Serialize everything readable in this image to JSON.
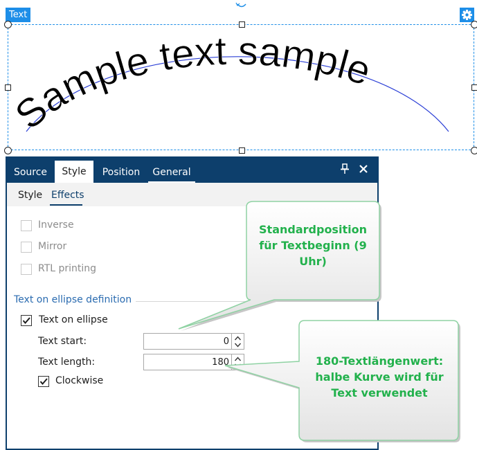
{
  "object": {
    "tag_label": "Text",
    "curved_text": "Sample text sample",
    "tag_color": "#1d8ee8"
  },
  "icons": {
    "settings": "gear-icon",
    "rotate": "rotate-icon",
    "pin": "pin-icon",
    "close": "close-icon",
    "checkmark": "checkmark-icon",
    "spin_up": "chevron-up-icon",
    "spin_down": "chevron-down-icon"
  },
  "panel": {
    "tabs": [
      {
        "label": "Source",
        "active": false
      },
      {
        "label": "Style",
        "active": true
      },
      {
        "label": "Position",
        "active": false
      },
      {
        "label": "General",
        "active": false
      }
    ],
    "subtabs": [
      {
        "label": "Style",
        "active": false
      },
      {
        "label": "Effects",
        "active": true
      }
    ],
    "header_color": "#0d3f6c"
  },
  "effects": {
    "inverse": {
      "label": "Inverse",
      "checked": false,
      "enabled": false
    },
    "mirror": {
      "label": "Mirror",
      "checked": false,
      "enabled": false
    },
    "rtl": {
      "label": "RTL printing",
      "checked": false,
      "enabled": false
    }
  },
  "ellipse": {
    "section_title": "Text on ellipse definition",
    "enable": {
      "label": "Text on ellipse",
      "checked": true
    },
    "text_start": {
      "label": "Text start:",
      "value": "0"
    },
    "text_length": {
      "label": "Text length:",
      "value": "180"
    },
    "clockwise": {
      "label": "Clockwise",
      "checked": true
    }
  },
  "callouts": [
    {
      "text": "Standardposition für Textbeginn (9 Uhr)"
    },
    {
      "text": "180-Textlängenwert: halbe Kurve wird für Text verwendet"
    }
  ],
  "callout_color": "#22b14c"
}
